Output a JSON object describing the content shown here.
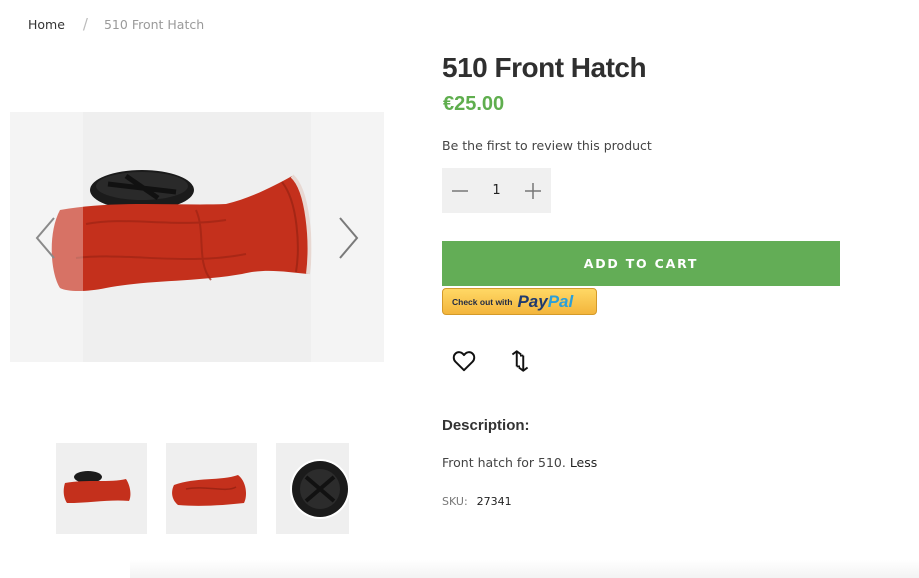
{
  "breadcrumb": {
    "home": "Home",
    "separator": "/",
    "current": "510 Front Hatch"
  },
  "product": {
    "title": "510 Front Hatch",
    "price": "€25.00",
    "review_link": "Be the first to review this product",
    "quantity": "1",
    "add_to_cart": "ADD TO CART",
    "paypal": {
      "checkout_text": "Check out with",
      "brand_pay": "Pay",
      "brand_pal": "Pal"
    },
    "description_heading": "Description:",
    "description_text": "Front hatch for 510. ",
    "description_toggle": "Less",
    "sku_label": "SKU:",
    "sku_value": "27341"
  },
  "gallery": {
    "thumbnail_count": 3,
    "prev_icon": "chevron-left-icon",
    "next_icon": "chevron-right-icon"
  },
  "icons": {
    "wishlist": "heart-icon",
    "compare": "compare-arrows-icon",
    "decrease": "minus-icon",
    "increase": "plus-icon"
  },
  "colors": {
    "price": "#5fae4e",
    "add_to_cart_bg": "#63ad56",
    "hatch_red": "#c4301c",
    "paypal_yellow": "#f3b53c"
  }
}
